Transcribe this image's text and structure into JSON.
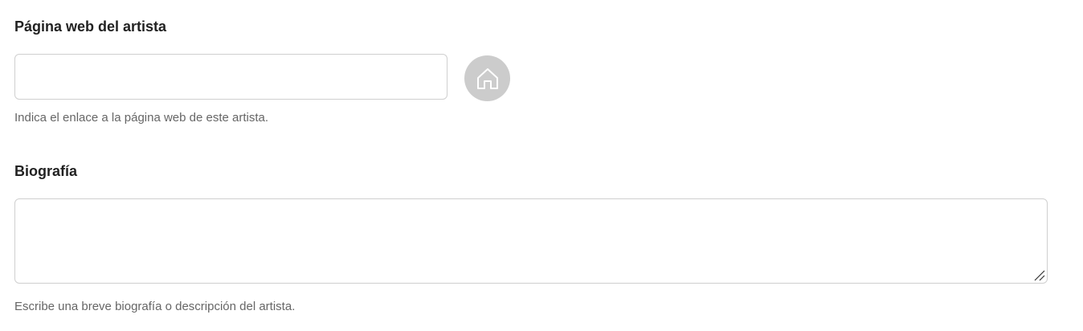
{
  "website": {
    "label": "Página web del artista",
    "value": "",
    "placeholder": "",
    "help": "Indica el enlace a la página web de este artista.",
    "button_icon": "home-icon"
  },
  "biography": {
    "label": "Biografía",
    "value": "",
    "placeholder": "",
    "help": "Escribe una breve biografía o descripción del artista."
  },
  "colors": {
    "button_bg": "#cccccc",
    "icon_stroke": "#ffffff",
    "border": "#cfcfcf",
    "help_text": "#666666"
  }
}
